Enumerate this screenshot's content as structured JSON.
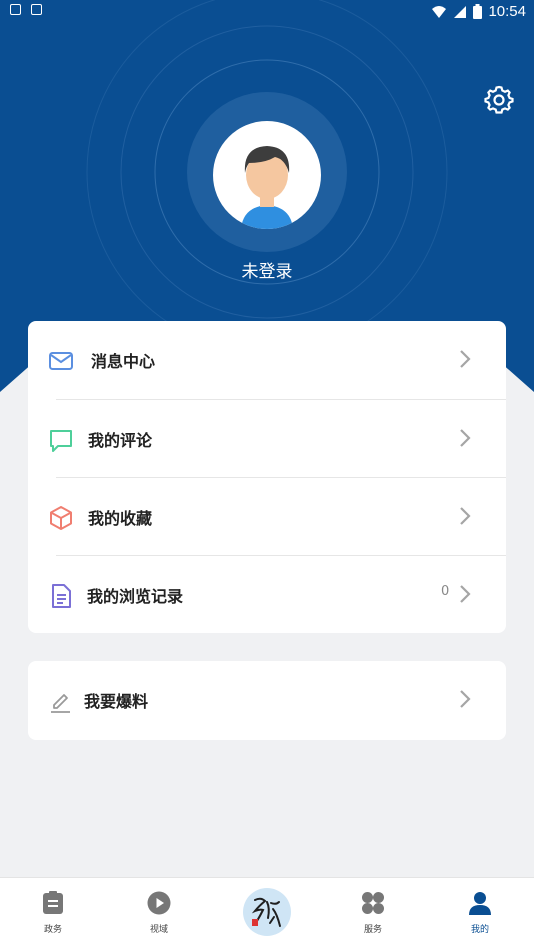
{
  "status_bar": {
    "time": "10:54",
    "left_icons": [
      "notification-icon",
      "app-icon"
    ],
    "right_icons": [
      "wifi-icon",
      "signal-icon",
      "battery-icon"
    ]
  },
  "header": {
    "login_label": "未登录",
    "bg_color": "#0a4e92"
  },
  "menu": {
    "items": [
      {
        "label": "消息中心",
        "icon": "mail-icon",
        "color": "#5b8fe0"
      },
      {
        "label": "我的评论",
        "icon": "comment-icon",
        "color": "#4ecf9a"
      },
      {
        "label": "我的收藏",
        "icon": "box-icon",
        "color": "#f07e70"
      },
      {
        "label": "我的浏览记录",
        "icon": "document-icon",
        "color": "#7b70d6",
        "count": "0"
      }
    ],
    "extra": {
      "label": "我要爆料",
      "icon": "pencil-icon"
    }
  },
  "tabbar": {
    "tabs": [
      {
        "label": "政务",
        "icon": "clipboard-icon"
      },
      {
        "label": "视域",
        "icon": "play-icon"
      },
      {
        "label": "",
        "icon": "calligraphy-logo"
      },
      {
        "label": "服务",
        "icon": "grid-icon"
      },
      {
        "label": "我的",
        "icon": "user-icon",
        "active": true
      }
    ],
    "active_color": "#0a4e92"
  }
}
